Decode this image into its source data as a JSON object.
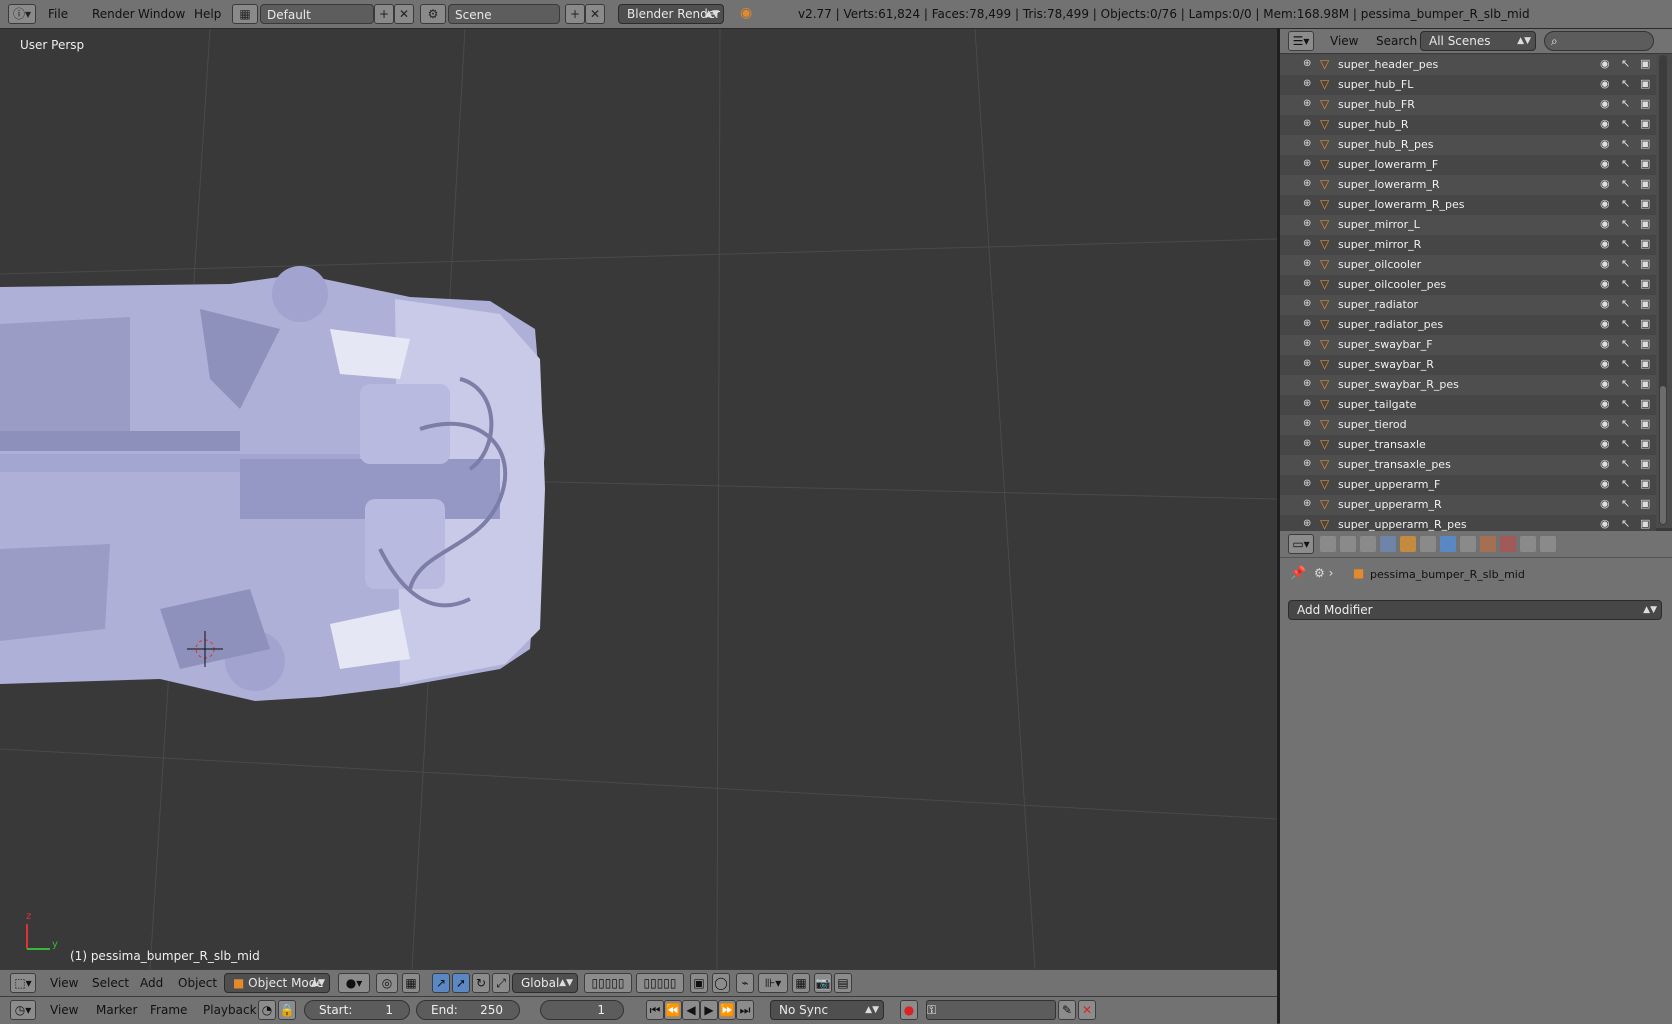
{
  "topbar": {
    "menus": [
      "File",
      "Render",
      "Window",
      "Help"
    ],
    "screen_layout": "Default",
    "scene": "Scene",
    "render_engine": "Blender Render",
    "stats": "v2.77 | Verts:61,824 | Faces:78,499 | Tris:78,499 | Objects:0/76 | Lamps:0/0 | Mem:168.98M | pessima_bumper_R_slb_mid"
  },
  "viewport": {
    "view_label": "User Persp",
    "active_object": "(1) pessima_bumper_R_slb_mid",
    "axis_labels": {
      "z": "z",
      "y": "y"
    }
  },
  "view3d_header": {
    "menus": [
      "View",
      "Select",
      "Add",
      "Object"
    ],
    "mode": "Object Mode",
    "orientation": "Global"
  },
  "timeline": {
    "menus": [
      "View",
      "Marker",
      "Frame",
      "Playback"
    ],
    "start_label": "Start:",
    "start_value": "1",
    "end_label": "End:",
    "end_value": "250",
    "current_frame": "1",
    "sync": "No Sync"
  },
  "outliner": {
    "menus": [
      "View",
      "Search"
    ],
    "display_mode": "All Scenes",
    "items": [
      "super_header_pes",
      "super_hub_FL",
      "super_hub_FR",
      "super_hub_R",
      "super_hub_R_pes",
      "super_lowerarm_F",
      "super_lowerarm_R",
      "super_lowerarm_R_pes",
      "super_mirror_L",
      "super_mirror_R",
      "super_oilcooler",
      "super_oilcooler_pes",
      "super_radiator",
      "super_radiator_pes",
      "super_swaybar_F",
      "super_swaybar_R",
      "super_swaybar_R_pes",
      "super_tailgate",
      "super_tierod",
      "super_transaxle",
      "super_transaxle_pes",
      "super_upperarm_F",
      "super_upperarm_R",
      "super_upperarm_R_pes"
    ]
  },
  "properties": {
    "object_name": "pessima_bumper_R_slb_mid",
    "add_modifier": "Add Modifier"
  },
  "colors": {
    "header_bg": "#727272",
    "viewport_bg": "#393939",
    "mesh": "#b4b6e0",
    "outliner_bg": "#4b4b4b",
    "accent_orange": "#e38a2b"
  }
}
